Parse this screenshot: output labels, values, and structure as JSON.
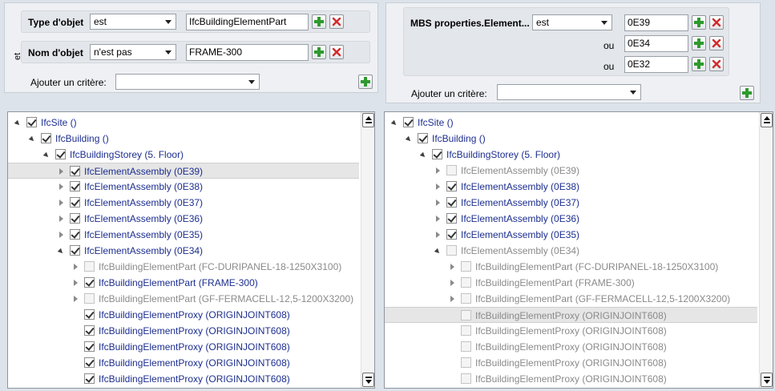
{
  "left_filter": {
    "criteria": [
      {
        "label": "Type d'objet",
        "operator": "est",
        "value": "IfcBuildingElementPart"
      },
      {
        "label": "Nom d'objet",
        "operator": "n'est pas",
        "value": "FRAME-300"
      }
    ],
    "connector": "et",
    "add_label": "Ajouter un critère:",
    "add_value": ""
  },
  "right_filter": {
    "criteria_label": "MBS properties.Element...",
    "operator": "est",
    "values": [
      "0E39",
      "0E34",
      "0E32"
    ],
    "or_label": "ou",
    "add_label": "Ajouter un critère:",
    "add_value": ""
  },
  "left_tree": [
    {
      "label": "IfcSite ()",
      "level": 0,
      "expander": "expanded",
      "checked": true,
      "style": "blue"
    },
    {
      "label": "IfcBuilding ()",
      "level": 1,
      "expander": "expanded",
      "checked": true,
      "style": "blue"
    },
    {
      "label": "IfcBuildingStorey (5. Floor)",
      "level": 2,
      "expander": "expanded",
      "checked": true,
      "style": "blue"
    },
    {
      "label": "IfcElementAssembly (0E39)",
      "level": 3,
      "expander": "collapsed",
      "checked": true,
      "style": "blue",
      "selected": true
    },
    {
      "label": "IfcElementAssembly (0E38)",
      "level": 3,
      "expander": "collapsed",
      "checked": true,
      "style": "blue"
    },
    {
      "label": "IfcElementAssembly (0E37)",
      "level": 3,
      "expander": "collapsed",
      "checked": true,
      "style": "blue"
    },
    {
      "label": "IfcElementAssembly (0E36)",
      "level": 3,
      "expander": "collapsed",
      "checked": true,
      "style": "blue"
    },
    {
      "label": "IfcElementAssembly (0E35)",
      "level": 3,
      "expander": "collapsed",
      "checked": true,
      "style": "blue"
    },
    {
      "label": "IfcElementAssembly (0E34)",
      "level": 3,
      "expander": "expanded",
      "checked": true,
      "style": "blue"
    },
    {
      "label": "IfcBuildingElementPart (FC-DURIPANEL-18-1250X3100)",
      "level": 4,
      "expander": "collapsed",
      "checked": false,
      "style": "gray"
    },
    {
      "label": "IfcBuildingElementPart (FRAME-300)",
      "level": 4,
      "expander": "collapsed",
      "checked": true,
      "style": "blue"
    },
    {
      "label": "IfcBuildingElementPart (GF-FERMACELL-12,5-1200X3200)",
      "level": 4,
      "expander": "collapsed",
      "checked": false,
      "style": "gray"
    },
    {
      "label": "IfcBuildingElementProxy (ORIGINJOINT608)",
      "level": 4,
      "expander": "none",
      "checked": true,
      "style": "blue"
    },
    {
      "label": "IfcBuildingElementProxy (ORIGINJOINT608)",
      "level": 4,
      "expander": "none",
      "checked": true,
      "style": "blue"
    },
    {
      "label": "IfcBuildingElementProxy (ORIGINJOINT608)",
      "level": 4,
      "expander": "none",
      "checked": true,
      "style": "blue"
    },
    {
      "label": "IfcBuildingElementProxy (ORIGINJOINT608)",
      "level": 4,
      "expander": "none",
      "checked": true,
      "style": "blue"
    },
    {
      "label": "IfcBuildingElementProxy (ORIGINJOINT608)",
      "level": 4,
      "expander": "none",
      "checked": true,
      "style": "blue"
    }
  ],
  "right_tree": [
    {
      "label": "IfcSite ()",
      "level": 0,
      "expander": "expanded",
      "checked": true,
      "style": "blue"
    },
    {
      "label": "IfcBuilding ()",
      "level": 1,
      "expander": "expanded",
      "checked": true,
      "style": "blue"
    },
    {
      "label": "IfcBuildingStorey (5. Floor)",
      "level": 2,
      "expander": "expanded",
      "checked": true,
      "style": "blue"
    },
    {
      "label": "IfcElementAssembly (0E39)",
      "level": 3,
      "expander": "collapsed",
      "checked": false,
      "style": "gray"
    },
    {
      "label": "IfcElementAssembly (0E38)",
      "level": 3,
      "expander": "collapsed",
      "checked": true,
      "style": "blue"
    },
    {
      "label": "IfcElementAssembly (0E37)",
      "level": 3,
      "expander": "collapsed",
      "checked": true,
      "style": "blue"
    },
    {
      "label": "IfcElementAssembly (0E36)",
      "level": 3,
      "expander": "collapsed",
      "checked": true,
      "style": "blue"
    },
    {
      "label": "IfcElementAssembly (0E35)",
      "level": 3,
      "expander": "collapsed",
      "checked": true,
      "style": "blue"
    },
    {
      "label": "IfcElementAssembly (0E34)",
      "level": 3,
      "expander": "expanded",
      "checked": false,
      "style": "gray"
    },
    {
      "label": "IfcBuildingElementPart (FC-DURIPANEL-18-1250X3100)",
      "level": 4,
      "expander": "collapsed",
      "checked": false,
      "style": "gray"
    },
    {
      "label": "IfcBuildingElementPart (FRAME-300)",
      "level": 4,
      "expander": "collapsed",
      "checked": false,
      "style": "gray"
    },
    {
      "label": "IfcBuildingElementPart (GF-FERMACELL-12,5-1200X3200)",
      "level": 4,
      "expander": "collapsed",
      "checked": false,
      "style": "gray"
    },
    {
      "label": "IfcBuildingElementProxy (ORIGINJOINT608)",
      "level": 4,
      "expander": "none",
      "checked": false,
      "style": "gray",
      "selected": true
    },
    {
      "label": "IfcBuildingElementProxy (ORIGINJOINT608)",
      "level": 4,
      "expander": "none",
      "checked": false,
      "style": "gray"
    },
    {
      "label": "IfcBuildingElementProxy (ORIGINJOINT608)",
      "level": 4,
      "expander": "none",
      "checked": false,
      "style": "gray"
    },
    {
      "label": "IfcBuildingElementProxy (ORIGINJOINT608)",
      "level": 4,
      "expander": "none",
      "checked": false,
      "style": "gray"
    },
    {
      "label": "IfcBuildingElementProxy (ORIGINJOINT608)",
      "level": 4,
      "expander": "none",
      "checked": false,
      "style": "gray"
    }
  ],
  "icons": {
    "add": "green-plus-icon",
    "remove": "red-x-icon",
    "dropdown": "chevron-down-icon"
  },
  "colors": {
    "label_blue": "#1c2e8f",
    "label_gray": "#8a8a8a",
    "add_green": "#2e9a2e",
    "remove_red": "#d42a2a"
  }
}
